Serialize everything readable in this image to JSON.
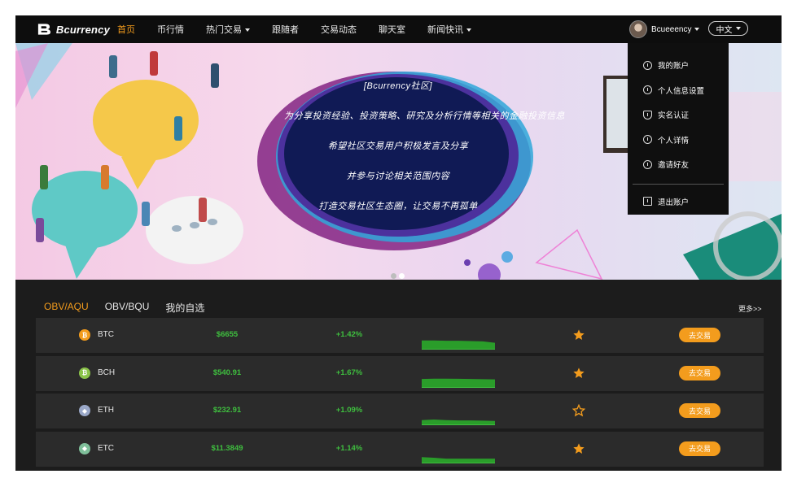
{
  "nav": {
    "logo_text": "Bcurrency",
    "items": [
      {
        "label": "首页",
        "active": true,
        "dropdown": false
      },
      {
        "label": "币行情",
        "active": false,
        "dropdown": false
      },
      {
        "label": "热门交易",
        "active": false,
        "dropdown": true
      },
      {
        "label": "跟随者",
        "active": false,
        "dropdown": false
      },
      {
        "label": "交易动态",
        "active": false,
        "dropdown": false
      },
      {
        "label": "聊天室",
        "active": false,
        "dropdown": false
      },
      {
        "label": "新闻快讯",
        "active": false,
        "dropdown": true
      }
    ],
    "username": "Bcueeency",
    "language": "中文"
  },
  "banner": {
    "lines": [
      "[Bcurrency社区]",
      "为分享投资经验、投资策略、研究及分析行情等相关的金融投资信息",
      "希望社区交易用户积极发言及分享",
      "并参与讨论相关范围内容",
      "打造交易社区生态圈，让交易不再孤单"
    ],
    "slide_count": 2,
    "active_slide": 2
  },
  "user_menu": {
    "items": [
      {
        "label": "我的账户",
        "icon": "info-circle-icon"
      },
      {
        "label": "个人信息设置",
        "icon": "user-circle-icon"
      },
      {
        "label": "实名认证",
        "icon": "shield-check-icon"
      },
      {
        "label": "个人详情",
        "icon": "info-circle-icon"
      },
      {
        "label": "邀请好友",
        "icon": "info-circle-icon"
      }
    ],
    "logout": {
      "label": "退出账户",
      "icon": "logout-icon"
    }
  },
  "market": {
    "tabs": [
      "OBV/AQU",
      "OBV/BQU",
      "我的自选"
    ],
    "active_tab": 0,
    "more_label": "更多>>",
    "trade_label": "去交易",
    "rows": [
      {
        "symbol": "BTC",
        "price": "$6655",
        "change": "+1.42%",
        "favorite": true,
        "icon_color": "#f39c1d",
        "icon": "bitcoin-icon",
        "trend": [
          0.8,
          0.8,
          0.78,
          0.78,
          0.75,
          0.72,
          0.6
        ]
      },
      {
        "symbol": "BCH",
        "price": "$540.91",
        "change": "+1.67%",
        "favorite": true,
        "icon_color": "#8bc34a",
        "icon": "bitcoin-cash-icon",
        "trend": [
          0.78,
          0.8,
          0.8,
          0.79,
          0.78,
          0.76,
          0.74
        ]
      },
      {
        "symbol": "ETH",
        "price": "$232.91",
        "change": "+1.09%",
        "favorite": false,
        "icon_color": "#9aa8c8",
        "icon": "ethereum-icon",
        "trend": [
          0.45,
          0.5,
          0.45,
          0.42,
          0.42,
          0.4,
          0.38
        ]
      },
      {
        "symbol": "ETC",
        "price": "$11.3849",
        "change": "+1.14%",
        "favorite": true,
        "icon_color": "#7fbf9a",
        "icon": "ethereum-classic-icon",
        "trend": [
          0.55,
          0.5,
          0.42,
          0.42,
          0.42,
          0.42,
          0.42
        ]
      }
    ],
    "colors": {
      "up": "#3fbf3f",
      "accent": "#f39c1d",
      "spark_fill": "#2a9d2a"
    }
  }
}
